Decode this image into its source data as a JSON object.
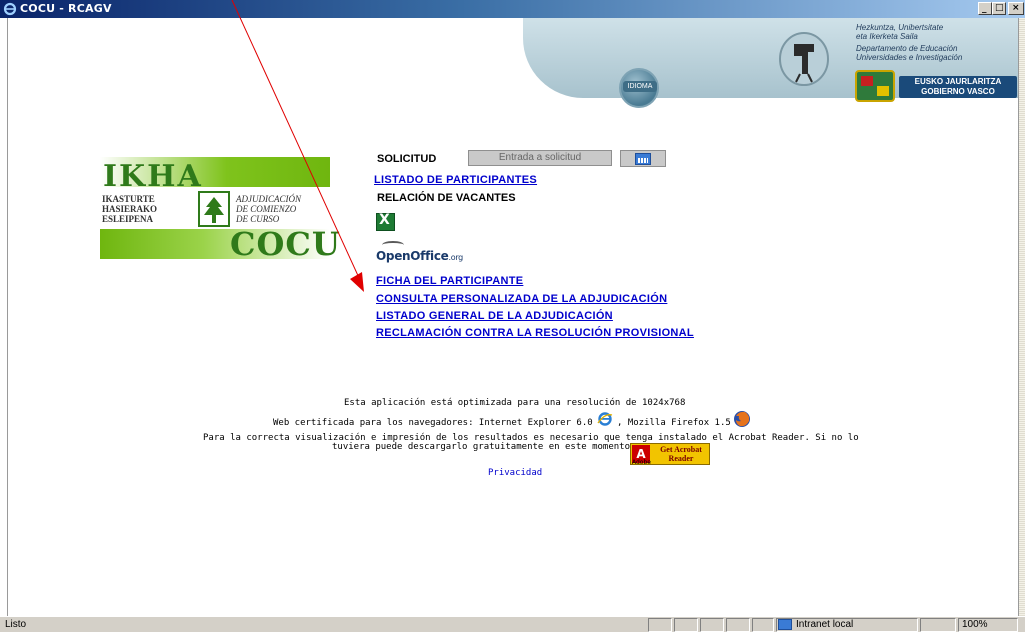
{
  "window": {
    "title": "COCU - RCAGV",
    "minimize_glyph": "_",
    "maximize_glyph": "□",
    "close_glyph": "×"
  },
  "banner": {
    "idioma_label": "IDIOMA",
    "dept_lines": [
      "Hezkuntza, Unibertsitate",
      "eta Ikerketa Saila",
      "Departamento de Educación",
      "Universidades e Investigación"
    ],
    "gov_lines": [
      "EUSKO JAURLARITZA",
      "GOBIERNO VASCO"
    ]
  },
  "logo": {
    "ikha": "IKHA",
    "cocu": "COCU",
    "basque_lines": [
      "IKASTURTE",
      "HASIERAKO",
      "ESLEIPENA"
    ],
    "spanish_lines": [
      "ADJUDICACIÓN",
      "DE COMIENZO",
      "DE CURSO"
    ]
  },
  "main": {
    "solicitud_label": "SOLICITUD",
    "entrada_button": "Entrada a solicitud",
    "listado_participantes": "LISTADO DE PARTICIPANTES",
    "relacion_vacantes": "RELACIÓN DE VACANTES",
    "excel_glyph": "X",
    "openoffice_main": "OpenOffice",
    "openoffice_suffix": ".org",
    "links": [
      "FICHA DEL PARTICIPANTE",
      "CONSULTA PERSONALIZADA DE LA ADJUDICACIÓN",
      "LISTADO GENERAL DE LA ADJUDICACIÓN",
      "RECLAMACIÓN CONTRA LA RESOLUCIÓN PROVISIONAL"
    ]
  },
  "footer": {
    "resolution_note": "Esta aplicación está optimizada para una resolución de  1024x768",
    "browsers_prefix": "Web certificada para los navegadores: Internet Explorer 6.0",
    "browsers_suffix": ", Mozilla Firefox 1.5",
    "acrobat_line1": "Para la correcta visualización e impresión de los resultados es necesario que tenga instalado el Acrobat Reader. Si no lo",
    "acrobat_line2": "tuviera puede descargarlo gratuitamente en este momento.",
    "acrobat_badge_line1": "Get Acrobat",
    "acrobat_badge_line2": "Reader",
    "acrobat_badge_adobe": "Adobe",
    "privacidad": "Privacidad"
  },
  "statusbar": {
    "status": "Listo",
    "zone": "Intranet local",
    "zoom": "100%"
  },
  "colors": {
    "title_bar": "#0a246a",
    "link": "#0000cc",
    "logo_green": "#6fb60f",
    "annotation_arrow": "#e00000"
  }
}
